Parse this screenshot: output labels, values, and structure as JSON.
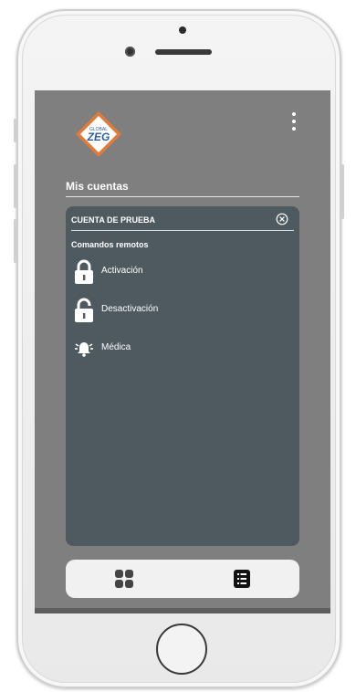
{
  "header": {
    "logo_text_top": "GLOBAL",
    "logo_text_main": "ZEG"
  },
  "section": {
    "title": "Mis cuentas"
  },
  "account": {
    "name": "CUENTA DE PRUEBA"
  },
  "commands": {
    "title": "Comandos remotos",
    "items": [
      {
        "label": "Activación",
        "icon": "lock-closed-icon"
      },
      {
        "label": "Desactivación",
        "icon": "lock-open-icon"
      },
      {
        "label": "Médica",
        "icon": "alarm-bell-icon"
      }
    ]
  },
  "nav": {
    "items": [
      {
        "icon": "grid-icon",
        "active": false
      },
      {
        "icon": "list-icon",
        "active": true
      }
    ]
  },
  "colors": {
    "background": "#7f7f7f",
    "panel": "#4f5a60",
    "logo_orange": "#e07b39",
    "logo_blue": "#2e5c9e"
  }
}
